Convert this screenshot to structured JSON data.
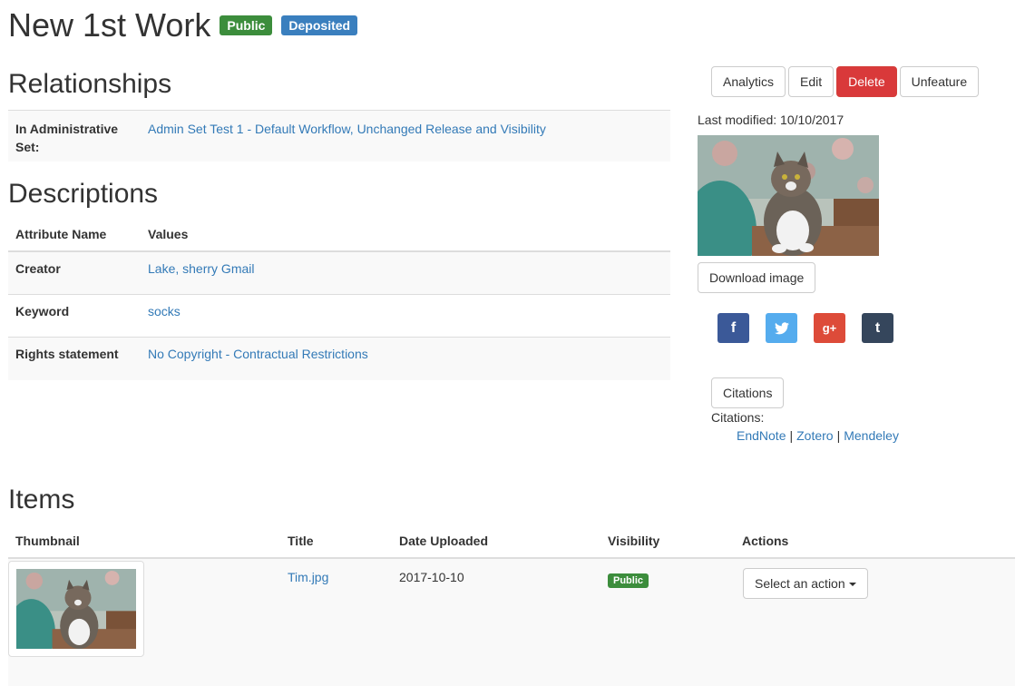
{
  "header": {
    "title": "New 1st Work",
    "badges": [
      {
        "label": "Public",
        "color": "#3c8d3c"
      },
      {
        "label": "Deposited",
        "color": "#3a7fbe"
      }
    ]
  },
  "relationships": {
    "heading": "Relationships",
    "rows": [
      {
        "key": "In Administrative Set:",
        "value": "Admin Set Test 1 - Default Workflow, Unchanged Release and Visibility"
      }
    ]
  },
  "descriptions": {
    "heading": "Descriptions",
    "columns": [
      "Attribute Name",
      "Values"
    ],
    "rows": [
      {
        "key": "Creator",
        "value": "Lake, sherry Gmail"
      },
      {
        "key": "Keyword",
        "value": "socks"
      },
      {
        "key": "Rights statement",
        "value": "No Copyright - Contractual Restrictions"
      }
    ]
  },
  "sidebar": {
    "buttons": [
      "Analytics",
      "Edit",
      "Delete",
      "Unfeature"
    ],
    "last_modified": "Last modified: 10/10/2017",
    "download_label": "Download image",
    "social_icons": [
      "facebook-icon",
      "twitter-icon",
      "google-plus-icon",
      "tumblr-icon"
    ],
    "social_glyphs": [
      "f",
      "t",
      "g+",
      "t"
    ],
    "citations_button": "Citations",
    "citations_label": "Citations:",
    "citation_links": [
      "EndNote",
      "Zotero",
      "Mendeley"
    ],
    "separator": "|"
  },
  "items": {
    "heading": "Items",
    "columns": [
      "Thumbnail",
      "Title",
      "Date Uploaded",
      "Visibility",
      "Actions"
    ],
    "rows": [
      {
        "title": "Tim.jpg",
        "date": "2017-10-10",
        "visibility": "Public",
        "action": "Select an action"
      }
    ]
  }
}
